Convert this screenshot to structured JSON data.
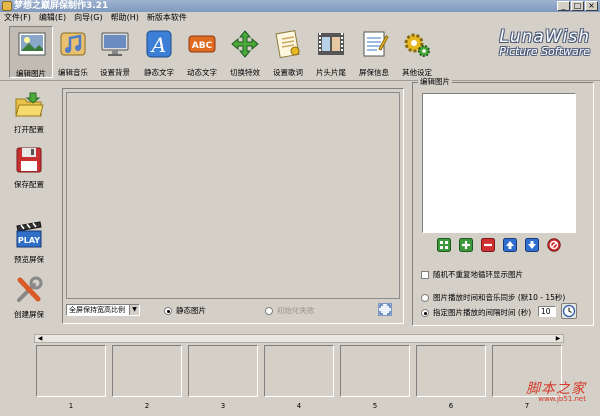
{
  "window": {
    "title": "梦想之巅屏保制作3.21",
    "controls": [
      "_",
      "□",
      "×"
    ]
  },
  "menu": [
    "文件(F)",
    "编辑(E)",
    "向导(G)",
    "帮助(H)",
    "新版本软件"
  ],
  "toolbar": [
    {
      "label": "编辑图片",
      "icon": "image-edit-icon",
      "color": "#8aa6c8",
      "active": true
    },
    {
      "label": "编辑音乐",
      "icon": "music-note-icon",
      "color": "#4f7cc4"
    },
    {
      "label": "设置背景",
      "icon": "monitor-icon",
      "color": "#6a8cc0"
    },
    {
      "label": "静态文字",
      "icon": "letter-a-icon",
      "color": "#3d7fd6"
    },
    {
      "label": "动态文字",
      "icon": "abc-text-icon",
      "color": "#e06a20"
    },
    {
      "label": "切换特效",
      "icon": "arrows-transition-icon",
      "color": "#4caa3a"
    },
    {
      "label": "设置歌词",
      "icon": "lyrics-doc-icon",
      "color": "#c9a860"
    },
    {
      "label": "片头片尾",
      "icon": "filmstrip-icon",
      "color": "#555555"
    },
    {
      "label": "屏保信息",
      "icon": "notepad-icon",
      "color": "#7fa6d8"
    },
    {
      "label": "其他设定",
      "icon": "gears-icon",
      "color": "#e8b820"
    }
  ],
  "brand": {
    "line1": "LunaWish",
    "line2": "Picture Software"
  },
  "side": [
    {
      "label": "打开配置",
      "icon": "open-folder-icon",
      "color": "#e9c24a"
    },
    {
      "label": "保存配置",
      "icon": "floppy-disk-icon",
      "color": "#c83030"
    },
    {
      "label": "预览屏保",
      "icon": "play-clapper-icon",
      "color": "#2f6fc8"
    },
    {
      "label": "创建屏保",
      "icon": "tools-icon",
      "color": "#d85a28"
    }
  ],
  "main": {
    "select_value": "全屏保持宽高比例",
    "radio_static": "静态图片",
    "radio_motion": "初始化失败"
  },
  "panel": {
    "title": "编辑图片",
    "buttons": [
      {
        "name": "grid-view-icon",
        "color": "#3c9a3c"
      },
      {
        "name": "add-icon",
        "color": "#3c9a3c"
      },
      {
        "name": "remove-icon",
        "color": "#d03030"
      },
      {
        "name": "move-up-icon",
        "color": "#2f6fd0"
      },
      {
        "name": "move-down-icon",
        "color": "#2f6fd0"
      },
      {
        "name": "clear-icon",
        "color": "#d03030"
      }
    ],
    "random_label": "随机不重复地循环显示图片",
    "opt_sync": "图片播放时间和音乐同步 (默10 - 15秒)",
    "opt_interval": "指定图片播放的间隔时间 (秒)",
    "interval_value": "10"
  },
  "thumbs": [
    "1",
    "2",
    "3",
    "4",
    "5",
    "6",
    "7"
  ],
  "watermark": {
    "text": "脚本之家",
    "sub": "www.jb51.net"
  }
}
